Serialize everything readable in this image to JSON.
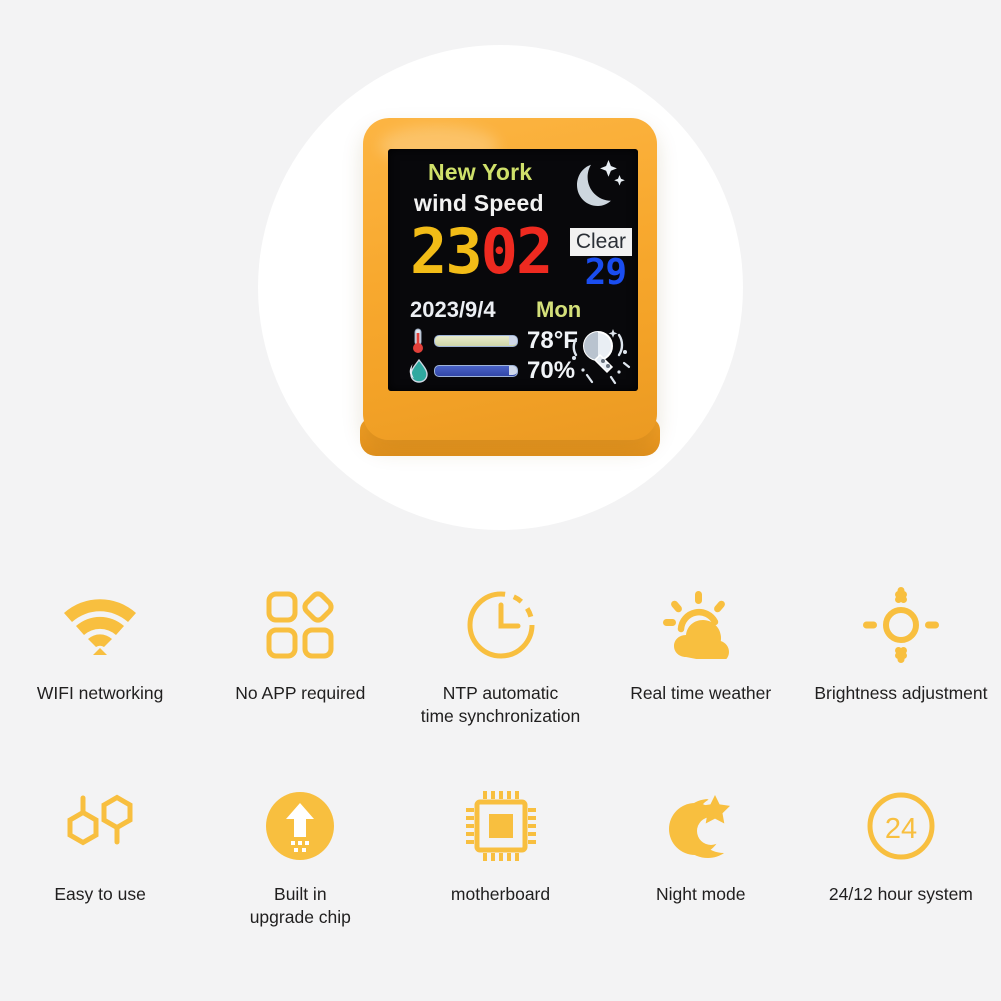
{
  "hero": {
    "device": {
      "bezel_color": "#f8a92f",
      "screen": {
        "city": "New York",
        "subtitle": "wind Speed",
        "night_icon": "moon-stars-icon",
        "time_hours": "23",
        "time_minutes": "02",
        "hours_color": "#f2bc17",
        "minutes_color": "#ee2a20",
        "condition": "Clear",
        "condition_value": "29",
        "condition_value_color": "#1a4df0",
        "date": "2023/9/4",
        "weekday": "Mon",
        "temperature": "78°F",
        "humidity": "70%",
        "temp_icon": "thermometer-icon",
        "humidity_icon": "water-drop-icon",
        "weather_icon": "meteor-icon"
      }
    }
  },
  "features": {
    "accent_color": "#f8bf3f",
    "rows": [
      [
        {
          "icon": "wifi-icon",
          "label": "WIFI networking"
        },
        {
          "icon": "apps-grid-icon",
          "label": "No APP required"
        },
        {
          "icon": "clock-icon",
          "label": "NTP automatic\ntime synchronization"
        },
        {
          "icon": "sun-cloud-icon",
          "label": "Real time weather"
        },
        {
          "icon": "sun-icon",
          "label": "Brightness adjustment"
        }
      ],
      [
        {
          "icon": "hexagon-molecule-icon",
          "label": "Easy to use"
        },
        {
          "icon": "upgrade-arrow-icon",
          "label": "Built in\nupgrade chip"
        },
        {
          "icon": "chip-icon",
          "label": "motherboard"
        },
        {
          "icon": "moon-star-icon",
          "label": "Night mode"
        },
        {
          "icon": "clock-24-icon",
          "label": "24/12 hour system"
        }
      ]
    ]
  }
}
